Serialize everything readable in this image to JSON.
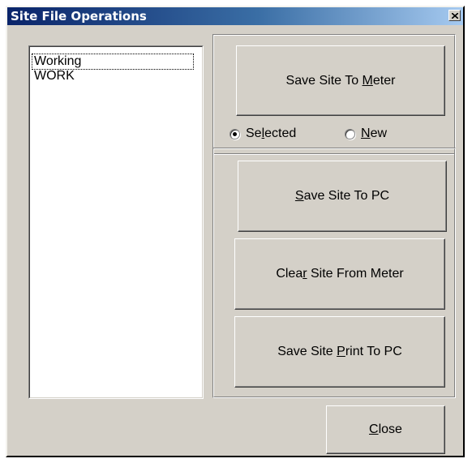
{
  "window": {
    "title": "Site File Operations",
    "close_glyph": "×"
  },
  "site_list": {
    "items": [
      "Working",
      "WORK"
    ],
    "selected_index": 0
  },
  "save_to_meter": {
    "label_pre": "Save Site To ",
    "label_key": "M",
    "label_post": "eter"
  },
  "target": {
    "options": [
      {
        "pre": "Se",
        "key": "l",
        "post": "ected",
        "checked": true
      },
      {
        "pre": "",
        "key": "N",
        "post": "ew",
        "checked": false
      }
    ]
  },
  "pc_actions": [
    {
      "pre": "",
      "key": "S",
      "post": "ave Site To PC"
    },
    {
      "pre": "Clea",
      "key": "r",
      "post": " Site From Meter"
    },
    {
      "pre": "Save Site ",
      "key": "P",
      "post": "rint To PC"
    }
  ],
  "close_button": {
    "pre": "",
    "key": "C",
    "post": "lose"
  },
  "colors": {
    "face": "#d4d0c8",
    "title_start": "#0a246a",
    "title_end": "#a6caf0"
  }
}
